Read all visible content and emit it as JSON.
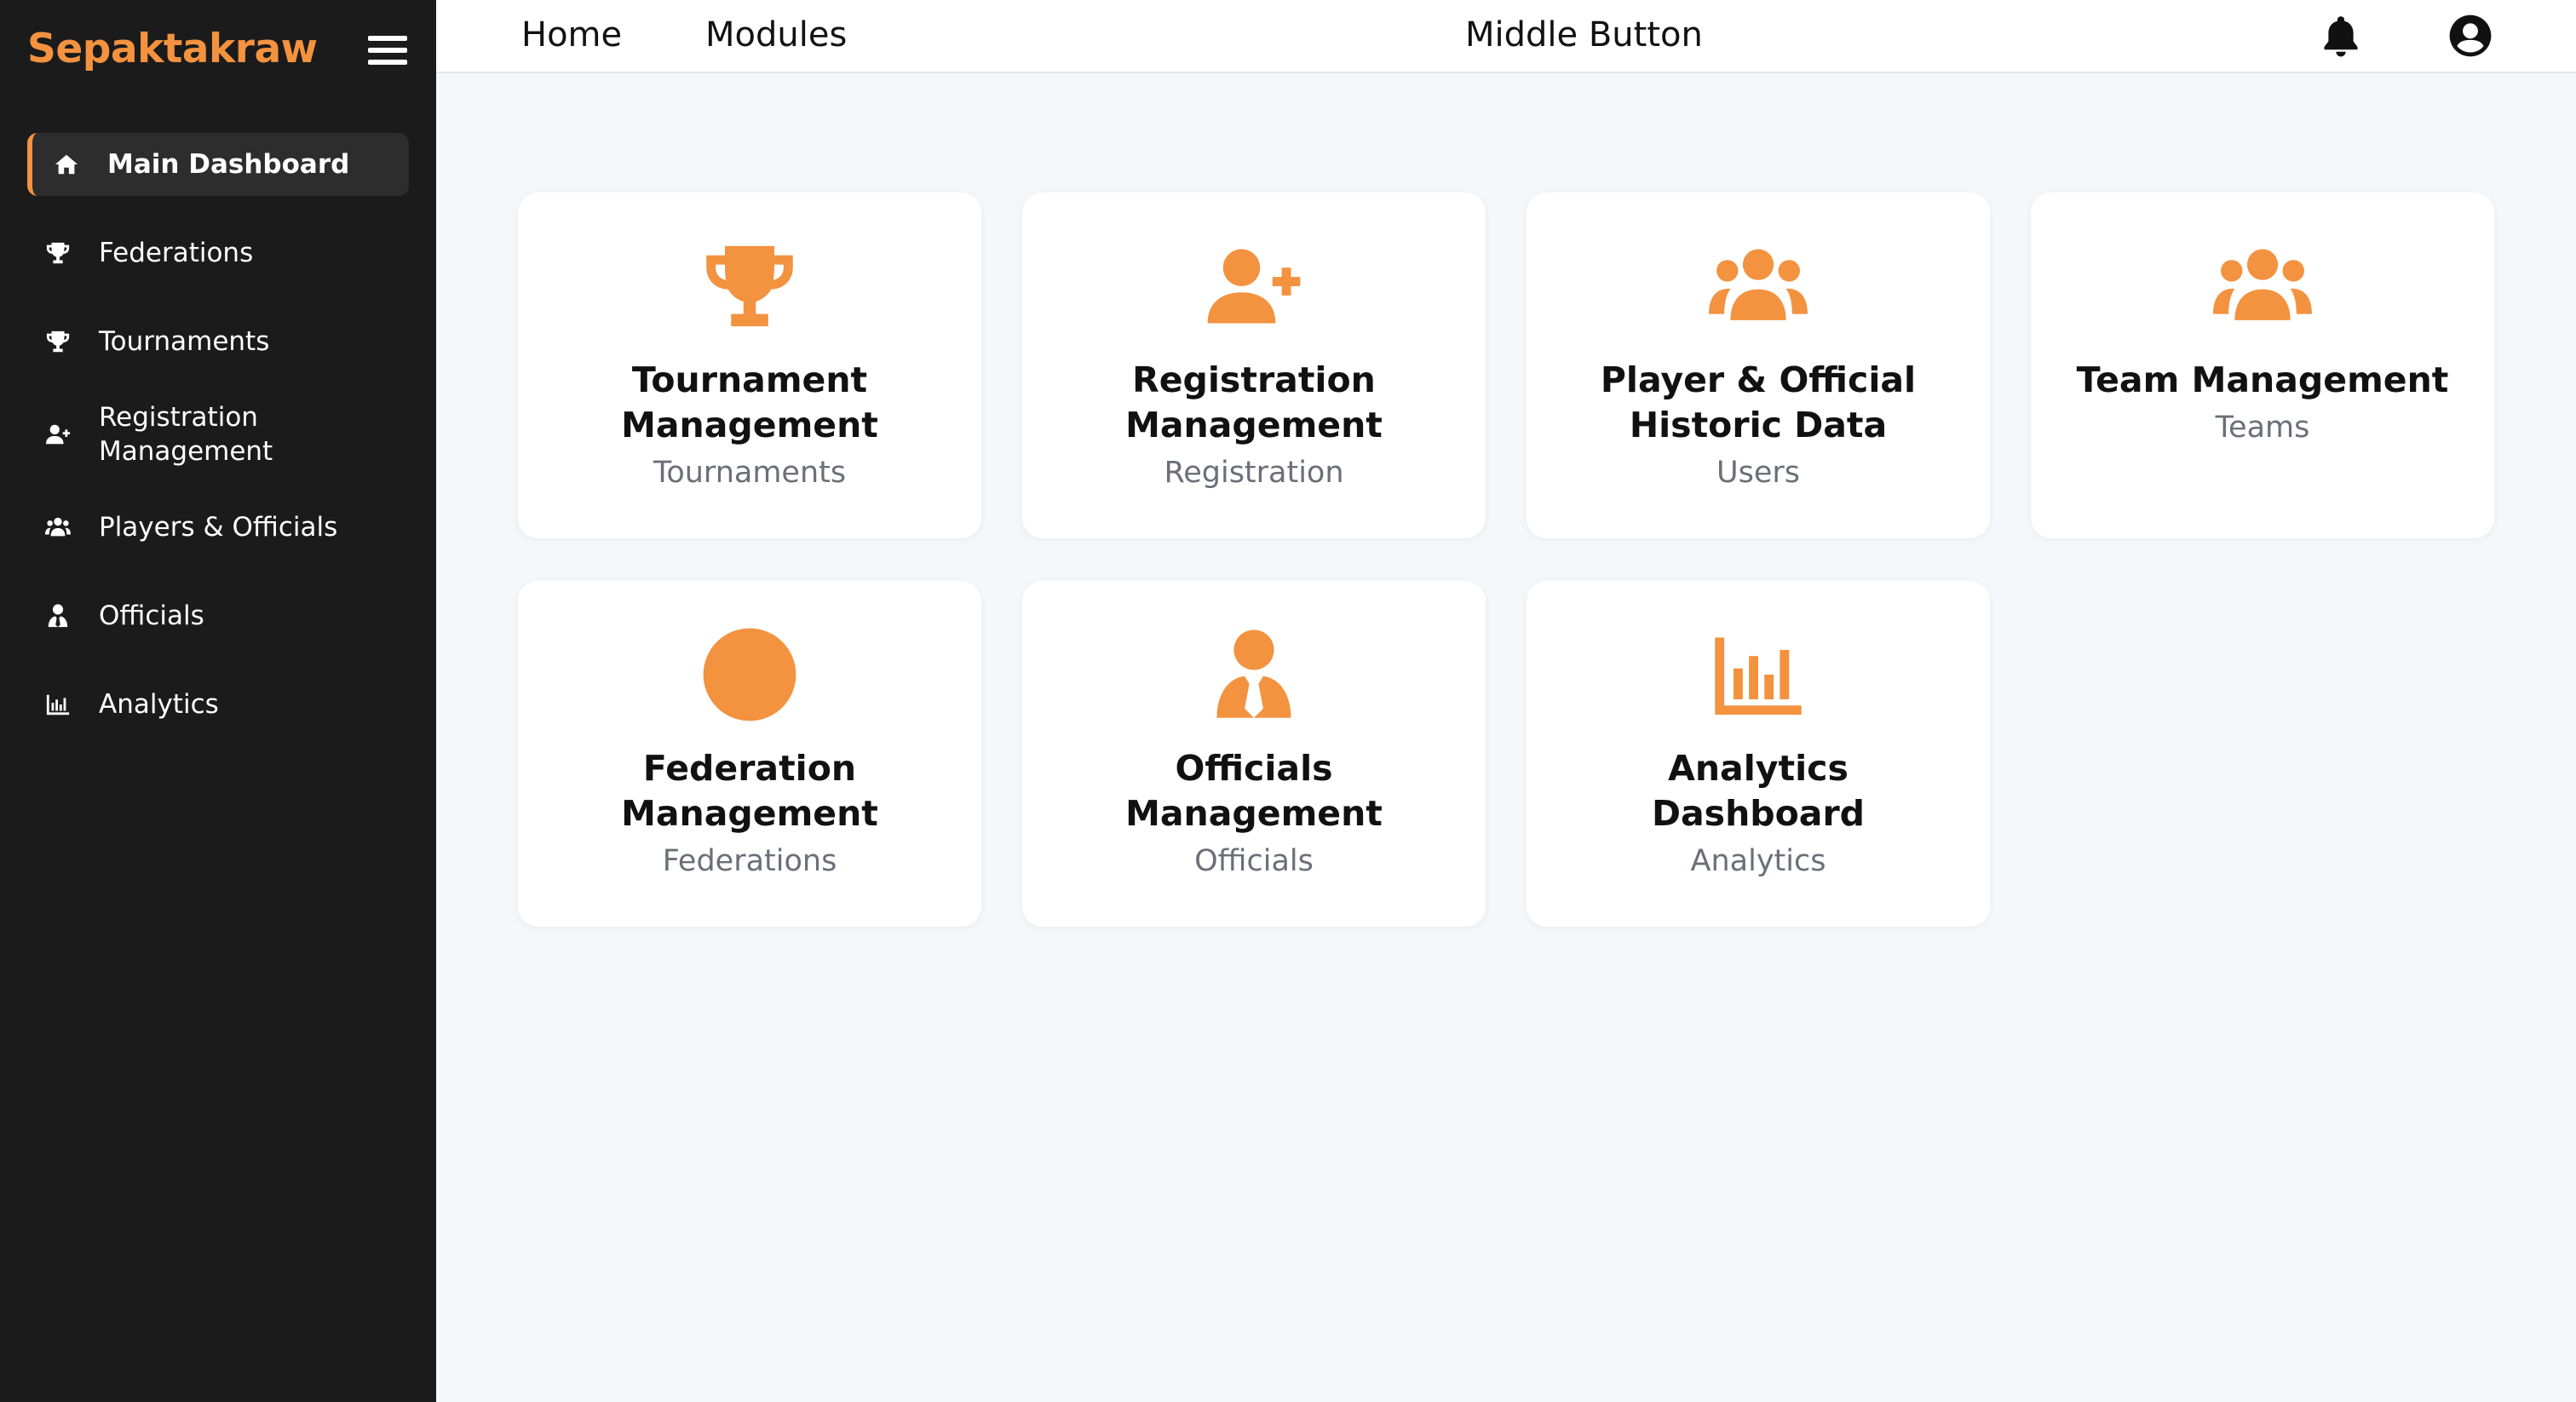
{
  "brand": "Sepaktakraw",
  "sidebar": {
    "items": [
      {
        "label": "Main Dashboard",
        "icon": "home-icon"
      },
      {
        "label": "Federations",
        "icon": "trophy-icon"
      },
      {
        "label": "Tournaments",
        "icon": "trophy-icon"
      },
      {
        "label": "Registration Management",
        "icon": "user-plus-icon"
      },
      {
        "label": "Players & Officials",
        "icon": "users-icon"
      },
      {
        "label": "Officials",
        "icon": "user-tie-icon"
      },
      {
        "label": "Analytics",
        "icon": "chart-bar-icon"
      }
    ]
  },
  "topbar": {
    "home": "Home",
    "modules": "Modules",
    "middle": "Middle Button",
    "icons": [
      "bell-icon",
      "user-circle-icon"
    ]
  },
  "cards": [
    {
      "title": "Tournament Management",
      "subtitle": "Tournaments",
      "icon": "trophy-icon"
    },
    {
      "title": "Registration Management",
      "subtitle": "Registration",
      "icon": "user-plus-icon"
    },
    {
      "title": "Player & Official Historic Data",
      "subtitle": "Users",
      "icon": "users-icon"
    },
    {
      "title": "Team Management",
      "subtitle": "Teams",
      "icon": "users-icon"
    },
    {
      "title": "Federation Management",
      "subtitle": "Federations",
      "icon": "globe-icon"
    },
    {
      "title": "Officials Management",
      "subtitle": "Officials",
      "icon": "user-tie-icon"
    },
    {
      "title": "Analytics Dashboard",
      "subtitle": "Analytics",
      "icon": "chart-bar-icon"
    }
  ],
  "colors": {
    "accent": "#f3923f",
    "sidebar_bg": "#1b1b1b",
    "page_bg": "#f5f7fa",
    "card_bg": "#ffffff"
  }
}
